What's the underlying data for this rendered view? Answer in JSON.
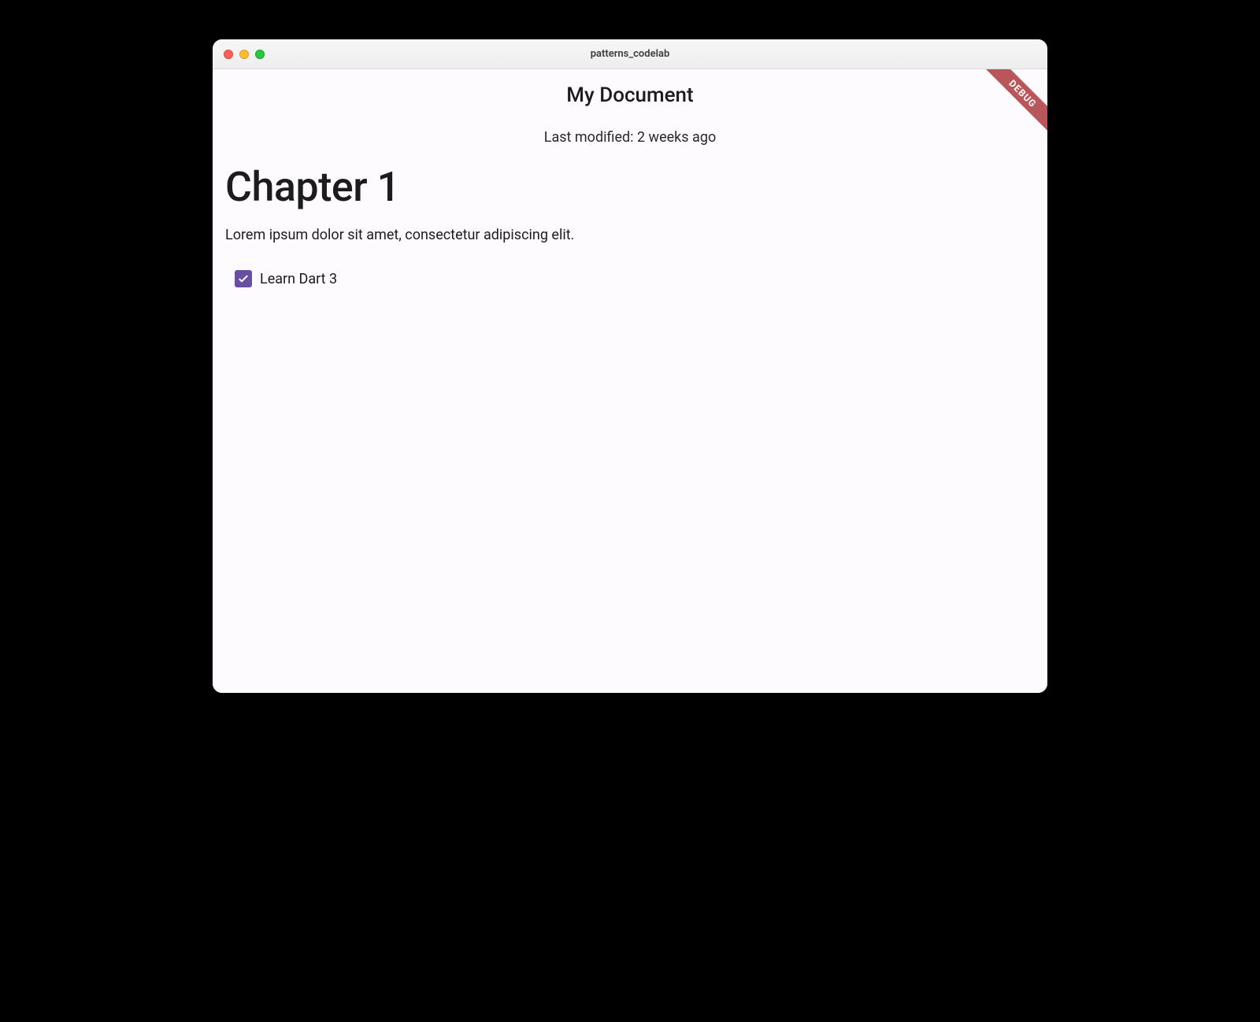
{
  "window": {
    "title": "patterns_codelab"
  },
  "debug_banner": "DEBUG",
  "header": {
    "title": "My Document",
    "subtitle": "Last modified: 2 weeks ago"
  },
  "content": {
    "heading": "Chapter 1",
    "paragraph": "Lorem ipsum dolor sit amet, consectetur adipiscing elit."
  },
  "todo": {
    "items": [
      {
        "label": "Learn Dart 3",
        "checked": true
      }
    ]
  },
  "colors": {
    "checkbox_accent": "#6750a4",
    "debug_banner": "#b9565b",
    "background": "#fefbff"
  }
}
